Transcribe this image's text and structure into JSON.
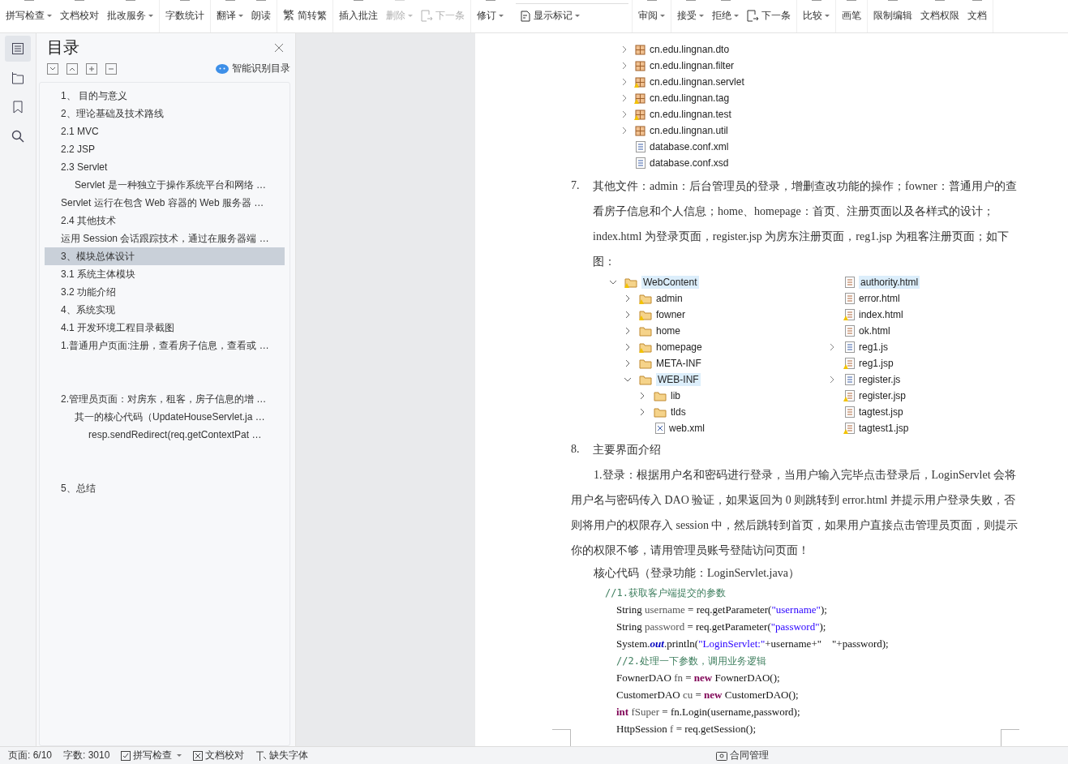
{
  "toolbar": {
    "groups": [
      {
        "items": [
          {
            "label": "拼写检查",
            "dropdown": true,
            "disabled": false
          },
          {
            "label": "文档校对",
            "dropdown": false,
            "disabled": false
          },
          {
            "label": "批改服务",
            "dropdown": true,
            "disabled": false
          }
        ]
      },
      {
        "items": [
          {
            "label": "字数统计",
            "dropdown": false,
            "disabled": false
          }
        ]
      },
      {
        "items": [
          {
            "label": "翻译",
            "dropdown": true,
            "disabled": false
          },
          {
            "label": "朗读",
            "dropdown": false,
            "disabled": false
          }
        ]
      },
      {
        "items": [
          {
            "label": "简转繁",
            "dropdown": false,
            "disabled": false,
            "glyph": "繁"
          }
        ]
      },
      {
        "items": [
          {
            "label": "插入批注",
            "dropdown": false,
            "disabled": false
          },
          {
            "label": "删除",
            "dropdown": true,
            "disabled": true
          },
          {
            "label": "下一条",
            "dropdown": false,
            "disabled": true,
            "kind": "inline"
          }
        ]
      },
      {
        "items": [
          {
            "label": "修订",
            "dropdown": true,
            "disabled": false
          },
          {
            "label": "显示标记",
            "dropdown": true,
            "disabled": false,
            "kind": "field"
          }
        ]
      },
      {
        "items": [
          {
            "label": "审阅",
            "dropdown": true,
            "disabled": false
          }
        ]
      },
      {
        "items": [
          {
            "label": "接受",
            "dropdown": true,
            "disabled": false
          },
          {
            "label": "拒绝",
            "dropdown": true,
            "disabled": false
          },
          {
            "label": "下一条",
            "dropdown": false,
            "disabled": false,
            "kind": "inline"
          }
        ]
      },
      {
        "items": [
          {
            "label": "比较",
            "dropdown": true,
            "disabled": false
          }
        ]
      },
      {
        "items": [
          {
            "label": "画笔",
            "dropdown": false,
            "disabled": false
          }
        ]
      },
      {
        "items": [
          {
            "label": "限制编辑",
            "dropdown": false,
            "disabled": false
          },
          {
            "label": "文档权限",
            "dropdown": false,
            "disabled": false
          },
          {
            "label": "文档",
            "dropdown": false,
            "disabled": false
          }
        ]
      }
    ]
  },
  "sidebar": {
    "title": "目录",
    "smart_button": "智能识别目录",
    "items": [
      {
        "label": "1、  目的与意义",
        "selected": false
      },
      {
        "label": "2、理论基础及技术路线",
        "selected": false
      },
      {
        "label": "2.1 MVC",
        "selected": false
      },
      {
        "label": "2.2 JSP",
        "selected": false
      },
      {
        "label": "2.3 Servlet",
        "selected": false,
        "children": [
          {
            "label": "Servlet 是一种独立于操作系统平台和网络 …",
            "selected": false
          }
        ]
      },
      {
        "label": "Servlet 运行在包含 Web 容器的 Web 服务器 …",
        "selected": false
      },
      {
        "label": "2.4  其他技术",
        "selected": false
      },
      {
        "label": "运用 Session 会话跟踪技术，通过在服务器端 …",
        "selected": false
      },
      {
        "label": "3、模块总体设计",
        "selected": true
      },
      {
        "label": "3.1 系统主体模块",
        "selected": false
      },
      {
        "label": "3.2 功能介绍",
        "selected": false
      },
      {
        "label": "4、系统实现",
        "selected": false
      },
      {
        "label": "4.1 开发环境工程目录截图",
        "selected": false
      },
      {
        "label": "1.普通用户页面:注册，查看房子信息，查看或 …",
        "selected": false,
        "gap_after": true
      },
      {
        "label": "2.管理员页面：对房东，租客，房子信息的增 …",
        "selected": false,
        "children": [
          {
            "label": "其一的核心代码（UpdateHouseServlet.ja …",
            "selected": false,
            "children": [
              {
                "label": "resp.sendRedirect(req.getContextPat …",
                "selected": false,
                "gap_after": true
              }
            ]
          }
        ]
      },
      {
        "label": "5、总结",
        "selected": false
      }
    ]
  },
  "document": {
    "tree_top": [
      {
        "label": "cn.edu.lingnan.dto",
        "kind": "package",
        "warning": false,
        "expandable": true
      },
      {
        "label": "cn.edu.lingnan.filter",
        "kind": "package",
        "warning": false,
        "expandable": true
      },
      {
        "label": "cn.edu.lingnan.servlet",
        "kind": "package",
        "warning": true,
        "expandable": true
      },
      {
        "label": "cn.edu.lingnan.tag",
        "kind": "package",
        "warning": true,
        "expandable": true
      },
      {
        "label": "cn.edu.lingnan.test",
        "kind": "package",
        "warning": true,
        "expandable": true
      },
      {
        "label": "cn.edu.lingnan.util",
        "kind": "package",
        "warning": false,
        "expandable": true
      },
      {
        "label": "database.conf.xml",
        "kind": "xml",
        "warning": false,
        "expandable": false
      },
      {
        "label": "database.conf.xsd",
        "kind": "xsd",
        "warning": false,
        "expandable": false
      }
    ],
    "item7": {
      "number": "7.",
      "text": "其他文件：admin：后台管理员的登录，增删查改功能的操作；fowner：普通用户的查看房子信息和个人信息；home、homepage：首页、注册页面以及各样式的设计；index.html 为登录页面，register.jsp 为房东注册页面，reg1.jsp 为租客注册页面；如下图："
    },
    "tree_left": [
      {
        "label": "WebContent",
        "kind": "folder",
        "warning": true,
        "expanded": true,
        "selected": true,
        "children": [
          {
            "label": "admin",
            "kind": "folder",
            "warning": true,
            "expanded": false,
            "selected": false
          },
          {
            "label": "fowner",
            "kind": "folder",
            "warning": true,
            "expanded": false,
            "selected": false
          },
          {
            "label": "home",
            "kind": "folder",
            "warning": false,
            "expanded": false,
            "selected": false
          },
          {
            "label": "homepage",
            "kind": "folder",
            "warning": true,
            "expanded": false,
            "selected": false
          },
          {
            "label": "META-INF",
            "kind": "folder",
            "warning": false,
            "expanded": false,
            "selected": false
          },
          {
            "label": "WEB-INF",
            "kind": "folder",
            "warning": false,
            "expanded": true,
            "selected": true,
            "children": [
              {
                "label": "lib",
                "kind": "folder",
                "warning": false,
                "expanded": false,
                "selected": false
              },
              {
                "label": "tlds",
                "kind": "folder",
                "warning": false,
                "expanded": false,
                "selected": false
              },
              {
                "label": "web.xml",
                "kind": "xml",
                "warning": false,
                "selected": false
              }
            ]
          }
        ]
      }
    ],
    "tree_right": [
      {
        "label": "authority.html",
        "kind": "html",
        "warning": false,
        "expandable": false,
        "selected": true
      },
      {
        "label": "error.html",
        "kind": "html",
        "warning": false,
        "expandable": false,
        "selected": false
      },
      {
        "label": "index.html",
        "kind": "html",
        "warning": true,
        "expandable": false,
        "selected": false
      },
      {
        "label": "ok.html",
        "kind": "html",
        "warning": false,
        "expandable": false,
        "selected": false
      },
      {
        "label": "reg1.js",
        "kind": "js",
        "warning": false,
        "expandable": true,
        "selected": false
      },
      {
        "label": "reg1.jsp",
        "kind": "html",
        "warning": true,
        "expandable": false,
        "selected": false
      },
      {
        "label": "register.js",
        "kind": "js",
        "warning": false,
        "expandable": true,
        "selected": false
      },
      {
        "label": "register.jsp",
        "kind": "html",
        "warning": true,
        "expandable": false,
        "selected": false
      },
      {
        "label": "tagtest.jsp",
        "kind": "html",
        "warning": false,
        "expandable": false,
        "selected": false
      },
      {
        "label": "tagtest1.jsp",
        "kind": "html",
        "warning": true,
        "expandable": false,
        "selected": false
      }
    ],
    "item8": {
      "number": "8.",
      "text": "主要界面介绍"
    },
    "paragraph": "1.登录：根据用户名和密码进行登录，当用户输入完毕点击登录后，LoginServlet 会将用户名与密码传入 DAO 验证，如果返回为 0 则跳转到 error.html 并提示用户登录失败，否则将用户的权限存入 session 中，然后跳转到首页，如果用户直接点击管理员页面，则提示你的权限不够，请用管理员账号登陆访问页面！",
    "code_caption": "核心代码（登录功能：LoginServlet.java）",
    "code": [
      {
        "indent": false,
        "tokens": [
          {
            "kind": "comment",
            "text": "//1.获取客户端提交的参数"
          }
        ]
      },
      {
        "indent": true,
        "tokens": [
          {
            "kind": "plain",
            "text": "String "
          },
          {
            "kind": "var",
            "text": "username"
          },
          {
            "kind": "plain",
            "text": " = req.getParameter("
          },
          {
            "kind": "string",
            "text": "\"username\""
          },
          {
            "kind": "plain",
            "text": ");"
          }
        ]
      },
      {
        "indent": true,
        "tokens": [
          {
            "kind": "plain",
            "text": "String "
          },
          {
            "kind": "var",
            "text": "password"
          },
          {
            "kind": "plain",
            "text": " = req.getParameter("
          },
          {
            "kind": "string",
            "text": "\"password\""
          },
          {
            "kind": "plain",
            "text": ");"
          }
        ]
      },
      {
        "indent": true,
        "tokens": [
          {
            "kind": "plain",
            "text": "System."
          },
          {
            "kind": "field",
            "text": "out"
          },
          {
            "kind": "plain",
            "text": ".println("
          },
          {
            "kind": "string",
            "text": "\"LoginServlet:\""
          },
          {
            "kind": "plain",
            "text": "+username+\"    \"+password);"
          }
        ]
      },
      {
        "indent": true,
        "tokens": [
          {
            "kind": "comment",
            "text": "//2.处理一下参数，调用业务逻辑"
          }
        ]
      },
      {
        "indent": true,
        "tokens": [
          {
            "kind": "plain",
            "text": "FownerDAO "
          },
          {
            "kind": "var",
            "text": "fn"
          },
          {
            "kind": "plain",
            "text": " = "
          },
          {
            "kind": "keyword",
            "text": "new"
          },
          {
            "kind": "plain",
            "text": " FownerDAO();"
          }
        ]
      },
      {
        "indent": true,
        "tokens": [
          {
            "kind": "plain",
            "text": "CustomerDAO "
          },
          {
            "kind": "var",
            "text": "cu"
          },
          {
            "kind": "plain",
            "text": " = "
          },
          {
            "kind": "keyword",
            "text": "new"
          },
          {
            "kind": "plain",
            "text": " CustomerDAO();"
          }
        ]
      },
      {
        "indent": true,
        "tokens": [
          {
            "kind": "keyword",
            "text": "int"
          },
          {
            "kind": "var",
            "text": " fSuper"
          },
          {
            "kind": "plain",
            "text": " = fn.Login(username,password);"
          }
        ]
      },
      {
        "indent": true,
        "tokens": [
          {
            "kind": "plain",
            "text": "HttpSession "
          },
          {
            "kind": "var",
            "text": "f"
          },
          {
            "kind": "plain",
            "text": " = req.getSession();"
          }
        ]
      }
    ]
  },
  "status_bar": {
    "page": "页面: 6/10",
    "words": "字数: 3010",
    "items": [
      {
        "label": "拼写检查",
        "kind": "check",
        "dropdown": true
      },
      {
        "label": "文档校对",
        "kind": "proof",
        "dropdown": false
      },
      {
        "label": "缺失字体",
        "kind": "font",
        "dropdown": false
      }
    ],
    "center": "合同管理"
  }
}
